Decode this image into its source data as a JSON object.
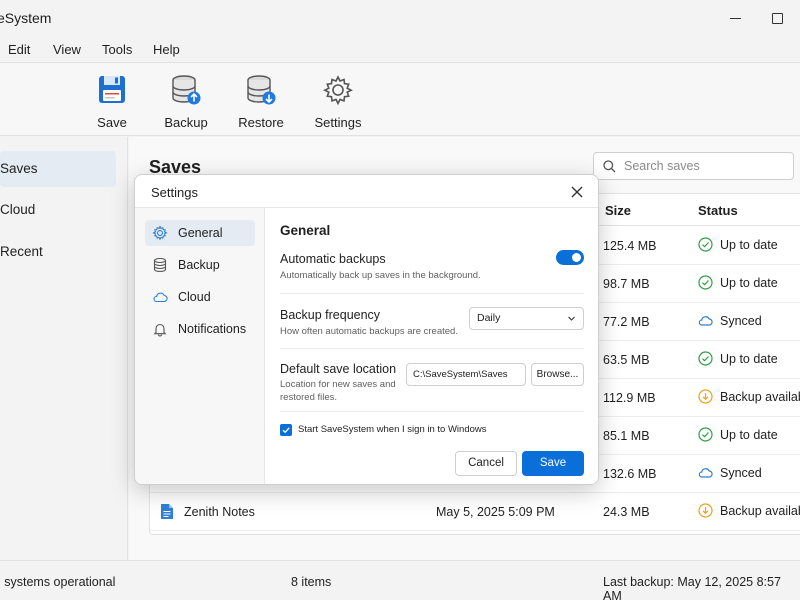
{
  "window": {
    "title": "veSystem"
  },
  "menu": [
    "Edit",
    "View",
    "Tools",
    "Help"
  ],
  "toolbar": [
    {
      "label": "Save",
      "icon": "floppy-disk-icon"
    },
    {
      "label": "Backup",
      "icon": "database-upload-icon"
    },
    {
      "label": "Restore",
      "icon": "database-download-icon"
    },
    {
      "label": "Settings",
      "icon": "gear-icon"
    }
  ],
  "sidebar": {
    "items": [
      "Saves",
      "Cloud",
      "Recent"
    ],
    "active": "Saves"
  },
  "main": {
    "title": "Saves",
    "search_placeholder": "Search saves",
    "columns": {
      "size": "Size",
      "status": "Status"
    },
    "rows": [
      {
        "size": "125.4 MB",
        "status": "Up to date",
        "status_type": "ok"
      },
      {
        "size": "98.7 MB",
        "status": "Up to date",
        "status_type": "ok"
      },
      {
        "size": "77.2 MB",
        "status": "Synced",
        "status_type": "cloud"
      },
      {
        "size": "63.5 MB",
        "status": "Up to date",
        "status_type": "ok"
      },
      {
        "size": "112.9 MB",
        "status": "Backup available",
        "status_type": "warn"
      },
      {
        "size": "85.1 MB",
        "status": "Up to date",
        "status_type": "ok"
      },
      {
        "size": "132.6 MB",
        "status": "Synced",
        "status_type": "cloud"
      },
      {
        "name": "Zenith Notes",
        "modified": "May 5, 2025 5:09 PM",
        "size": "24.3 MB",
        "status": "Backup available",
        "status_type": "warn"
      }
    ]
  },
  "statusbar": {
    "left": "l systems operational",
    "center": "8 items",
    "right": "Last backup: May 12, 2025 8:57 AM"
  },
  "dialog": {
    "title": "Settings",
    "nav": [
      {
        "label": "General",
        "icon": "gear-icon"
      },
      {
        "label": "Backup",
        "icon": "database-icon"
      },
      {
        "label": "Cloud",
        "icon": "cloud-icon"
      },
      {
        "label": "Notifications",
        "icon": "bell-icon"
      }
    ],
    "active_nav": "General",
    "section_title": "General",
    "auto_backups": {
      "label": "Automatic backups",
      "desc": "Automatically back up saves in the background.",
      "enabled": true
    },
    "frequency": {
      "label": "Backup frequency",
      "desc": "How often automatic backups are created.",
      "value": "Daily"
    },
    "location": {
      "label": "Default save location",
      "desc_line1": "Location for new saves and",
      "desc_line2": "restored files.",
      "path": "C:\\SaveSystem\\Saves",
      "browse": "Browse..."
    },
    "startup": {
      "label": "Start SaveSystem when I sign in to Windows",
      "checked": true
    },
    "cancel": "Cancel",
    "save": "Save"
  },
  "colors": {
    "accent": "#0a6fd8",
    "ok": "#2e9e46",
    "warn": "#e8a317",
    "cloud": "#2f7fd6"
  }
}
